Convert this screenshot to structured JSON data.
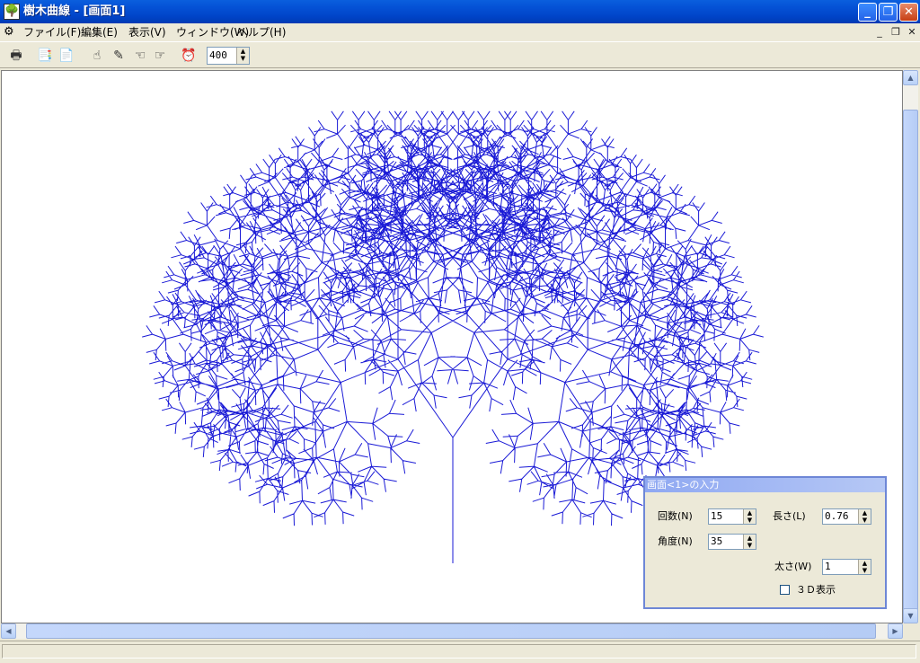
{
  "window": {
    "title": "樹木曲線 - [画面1]"
  },
  "menu": {
    "items": [
      "ファイル(F)",
      "編集(E)",
      "表示(V)",
      "ウィンドウ(W)",
      "ヘルプ(H)"
    ]
  },
  "toolbar": {
    "zoom_value": "400"
  },
  "dialog": {
    "title": "画面<1>の入力",
    "count_label": "回数(N)",
    "count_value": "15",
    "length_label": "長さ(L)",
    "length_value": "0.76",
    "angle_label": "角度(N)",
    "angle_value": "35",
    "width_label": "太さ(W)",
    "width_value": "1",
    "three_d_label": "３Ｄ表示",
    "three_d_checked": false
  },
  "drawing": {
    "color": "#1A1AD6",
    "iterations": 15,
    "length_ratio": 0.76,
    "angle_deg": 35
  }
}
